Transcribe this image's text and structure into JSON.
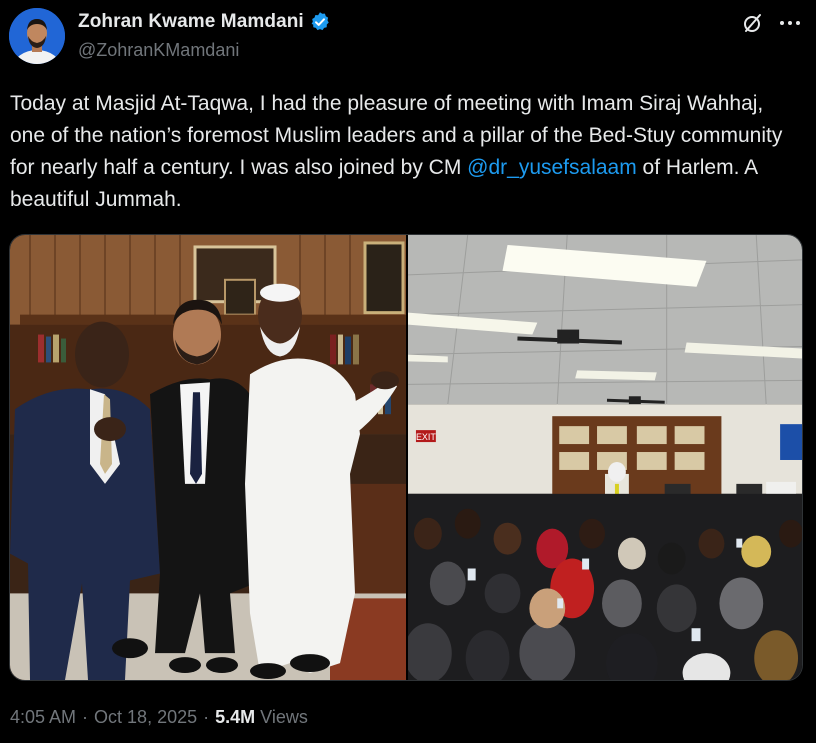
{
  "author": {
    "display_name": "Zohran Kwame Mamdani",
    "handle": "@ZohranKMamdani",
    "verified": true
  },
  "post": {
    "text_before_mention": "Today at Masjid At-Taqwa, I had the pleasure of meeting with Imam Siraj Wahhaj, one of the nation’s foremost Muslim leaders and a pillar of the Bed-Stuy community for nearly half a century. I was also joined by CM ",
    "mention": "@dr_yusefsalaam",
    "text_after_mention": " of Harlem. A beautiful Jummah."
  },
  "media": {
    "photo_count": 2,
    "exit_sign": "EXIT"
  },
  "meta": {
    "time": "4:05 AM",
    "separator": "·",
    "date": "Oct 18, 2025",
    "views_count": "5.4M",
    "views_label": "Views"
  },
  "icons": {
    "verified": "verified-badge-icon",
    "grok": "grok-icon",
    "more": "more-options-icon"
  },
  "colors": {
    "background": "#000000",
    "text_primary": "#e7e9ea",
    "text_secondary": "#71767b",
    "accent": "#1d9bf0"
  }
}
